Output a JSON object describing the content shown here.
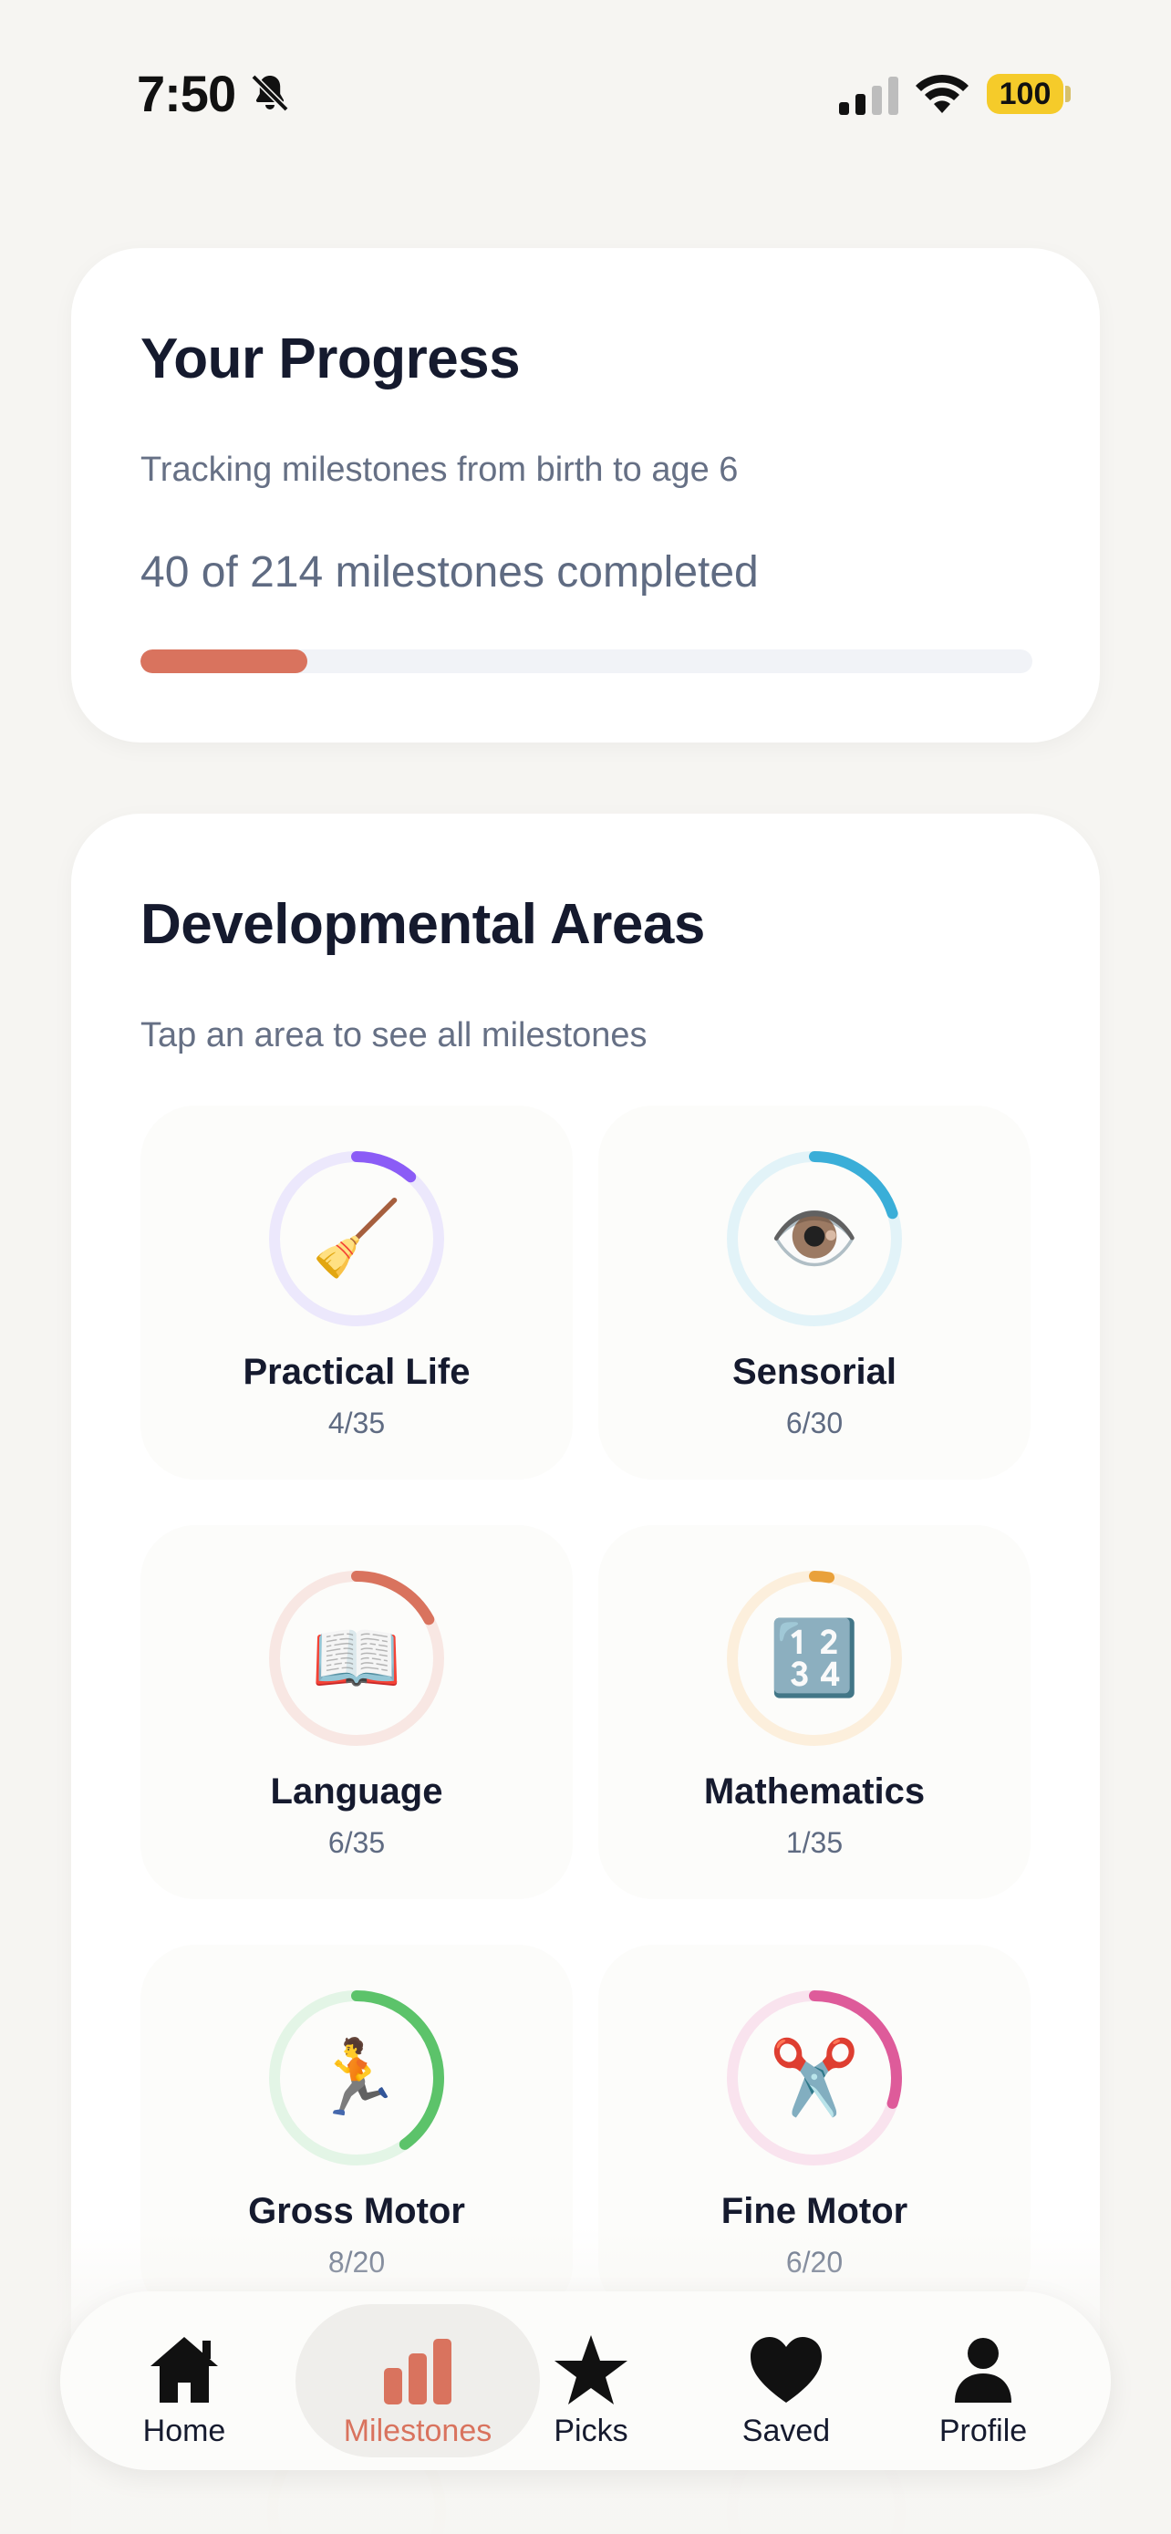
{
  "status_bar": {
    "time": "7:50",
    "battery": "100"
  },
  "progress": {
    "title": "Your Progress",
    "subtitle": "Tracking milestones from birth to age 6",
    "count_text": "40 of 214 milestones completed",
    "completed": 40,
    "total": 214,
    "accent_color": "#d9735e"
  },
  "areas": {
    "title": "Developmental Areas",
    "subtitle": "Tap an area to see all milestones",
    "items": [
      {
        "name": "Practical Life",
        "count": "4/35",
        "done": 4,
        "total": 35,
        "emoji": "🧹",
        "icon": "broom-icon",
        "color": "#8b5cf6",
        "track": "#ece8fc"
      },
      {
        "name": "Sensorial",
        "count": "6/30",
        "done": 6,
        "total": 30,
        "emoji": "👁️",
        "icon": "eye-icon",
        "color": "#3aaed8",
        "track": "#e2f3f8"
      },
      {
        "name": "Language",
        "count": "6/35",
        "done": 6,
        "total": 35,
        "emoji": "📖",
        "icon": "open-book-icon",
        "color": "#d9735e",
        "track": "#f8e7e3"
      },
      {
        "name": "Mathematics",
        "count": "1/35",
        "done": 1,
        "total": 35,
        "emoji": "🔢",
        "icon": "numbers-icon",
        "color": "#e9a13b",
        "track": "#fcefdc"
      },
      {
        "name": "Gross Motor",
        "count": "8/20",
        "done": 8,
        "total": 20,
        "emoji": "🏃",
        "icon": "running-person-icon",
        "color": "#5cc36a",
        "track": "#e3f5e6"
      },
      {
        "name": "Fine Motor",
        "count": "6/20",
        "done": 6,
        "total": 20,
        "emoji": "✂️",
        "icon": "scissors-icon",
        "color": "#de5b9a",
        "track": "#f9e3ee"
      }
    ]
  },
  "tabs": [
    {
      "label": "Home",
      "icon": "home-icon"
    },
    {
      "label": "Milestones",
      "icon": "bar-chart-icon",
      "active": true
    },
    {
      "label": "Picks",
      "icon": "star-icon"
    },
    {
      "label": "Saved",
      "icon": "heart-icon"
    },
    {
      "label": "Profile",
      "icon": "person-icon"
    }
  ]
}
